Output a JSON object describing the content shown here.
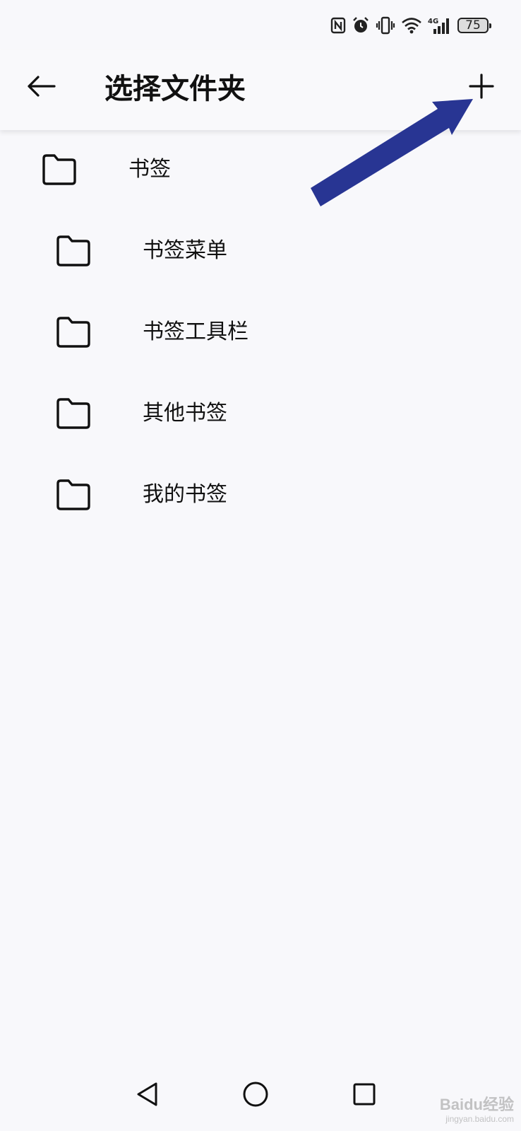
{
  "status_bar": {
    "battery_level": "75",
    "network_label": "4G",
    "icons": [
      "nfc-icon",
      "alarm-icon",
      "vibrate-icon",
      "wifi-icon",
      "cellular-signal-icon",
      "battery-icon"
    ]
  },
  "header": {
    "title": "选择文件夹",
    "back_icon": "arrow-left-icon",
    "add_icon": "plus-icon"
  },
  "folders": [
    {
      "label": "书签",
      "level": 0
    },
    {
      "label": "书签菜单",
      "level": 1
    },
    {
      "label": "书签工具栏",
      "level": 1
    },
    {
      "label": "其他书签",
      "level": 1
    },
    {
      "label": "我的书签",
      "level": 1
    }
  ],
  "nav_bar": {
    "icons": [
      "back-triangle-icon",
      "home-circle-icon",
      "recents-square-icon"
    ]
  },
  "annotation": {
    "color": "#283593"
  },
  "watermark": {
    "brand": "Baidu经验",
    "domain": "jingyan.baidu.com"
  }
}
